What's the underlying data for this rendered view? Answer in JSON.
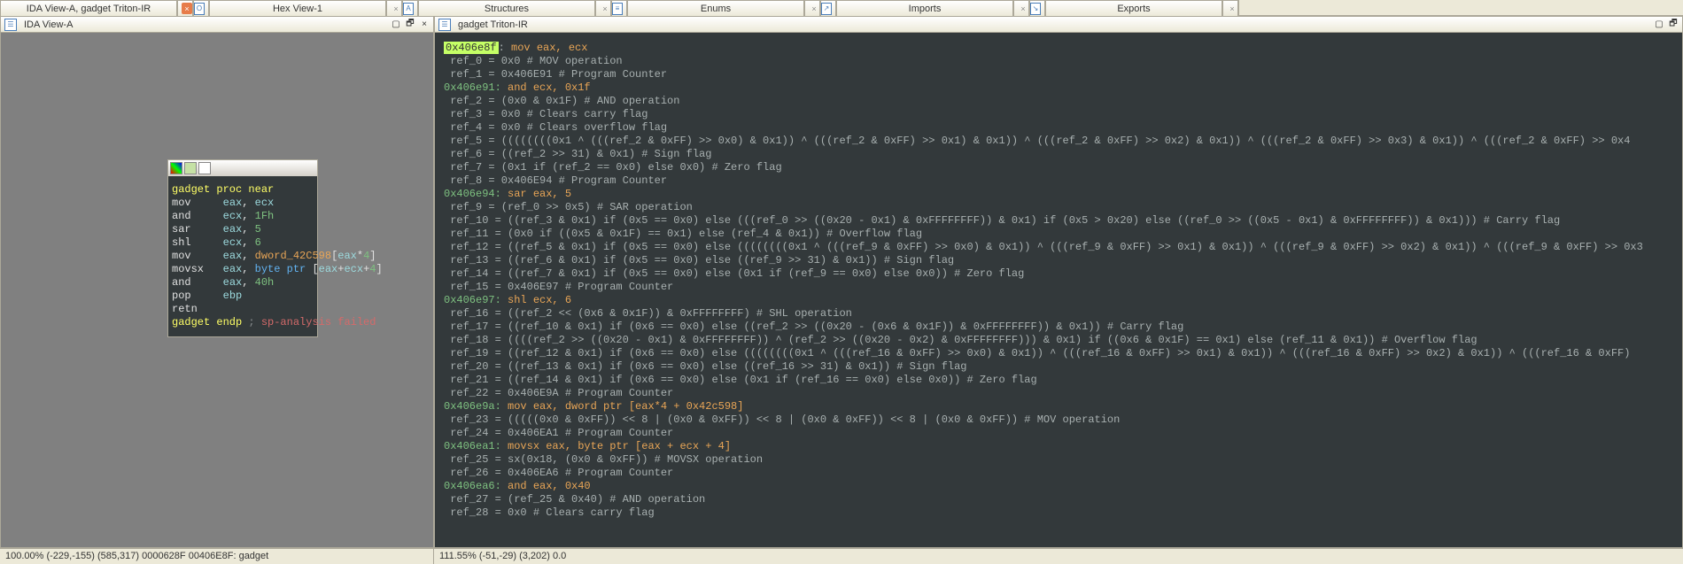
{
  "tabs": [
    {
      "label": "IDA View-A, gadget Triton-IR",
      "icon": "",
      "close_style": "orange"
    },
    {
      "label": "Hex View-1",
      "icon": "O"
    },
    {
      "label": "Structures",
      "icon": "A"
    },
    {
      "label": "Enums",
      "icon": "≡"
    },
    {
      "label": "Imports",
      "icon": "↗"
    },
    {
      "label": "Exports",
      "icon": "↘"
    }
  ],
  "left_pane": {
    "title": "IDA View-A",
    "code": [
      [
        {
          "t": "gadget proc near",
          "c": "hl-yellow"
        }
      ],
      [
        {
          "t": "mov",
          "c": "hl-white"
        },
        {
          "t": "     ",
          "c": ""
        },
        {
          "t": "eax",
          "c": "hl-lightblue"
        },
        {
          "t": ", ",
          "c": "hl-white"
        },
        {
          "t": "ecx",
          "c": "hl-lightblue"
        }
      ],
      [
        {
          "t": "and",
          "c": "hl-white"
        },
        {
          "t": "     ",
          "c": ""
        },
        {
          "t": "ecx",
          "c": "hl-lightblue"
        },
        {
          "t": ", ",
          "c": "hl-white"
        },
        {
          "t": "1Fh",
          "c": "hl-green"
        }
      ],
      [
        {
          "t": "sar",
          "c": "hl-white"
        },
        {
          "t": "     ",
          "c": ""
        },
        {
          "t": "eax",
          "c": "hl-lightblue"
        },
        {
          "t": ", ",
          "c": "hl-white"
        },
        {
          "t": "5",
          "c": "hl-green"
        }
      ],
      [
        {
          "t": "shl",
          "c": "hl-white"
        },
        {
          "t": "     ",
          "c": ""
        },
        {
          "t": "ecx",
          "c": "hl-lightblue"
        },
        {
          "t": ", ",
          "c": "hl-white"
        },
        {
          "t": "6",
          "c": "hl-green"
        }
      ],
      [
        {
          "t": "mov",
          "c": "hl-white"
        },
        {
          "t": "     ",
          "c": ""
        },
        {
          "t": "eax",
          "c": "hl-lightblue"
        },
        {
          "t": ", ",
          "c": "hl-white"
        },
        {
          "t": "dword_42C598",
          "c": "hl-orange"
        },
        {
          "t": "[",
          "c": "hl-white"
        },
        {
          "t": "eax",
          "c": "hl-lightblue"
        },
        {
          "t": "*",
          "c": "hl-white"
        },
        {
          "t": "4",
          "c": "hl-green"
        },
        {
          "t": "]",
          "c": "hl-white"
        }
      ],
      [
        {
          "t": "movsx",
          "c": "hl-white"
        },
        {
          "t": "   ",
          "c": ""
        },
        {
          "t": "eax",
          "c": "hl-lightblue"
        },
        {
          "t": ", ",
          "c": "hl-white"
        },
        {
          "t": "byte ptr ",
          "c": "hl-blue"
        },
        {
          "t": "[",
          "c": "hl-white"
        },
        {
          "t": "eax",
          "c": "hl-lightblue"
        },
        {
          "t": "+",
          "c": "hl-white"
        },
        {
          "t": "ecx",
          "c": "hl-lightblue"
        },
        {
          "t": "+",
          "c": "hl-white"
        },
        {
          "t": "4",
          "c": "hl-green"
        },
        {
          "t": "]",
          "c": "hl-white"
        }
      ],
      [
        {
          "t": "and",
          "c": "hl-white"
        },
        {
          "t": "     ",
          "c": ""
        },
        {
          "t": "eax",
          "c": "hl-lightblue"
        },
        {
          "t": ", ",
          "c": "hl-white"
        },
        {
          "t": "40h",
          "c": "hl-green"
        }
      ],
      [
        {
          "t": "pop",
          "c": "hl-white"
        },
        {
          "t": "     ",
          "c": ""
        },
        {
          "t": "ebp",
          "c": "hl-lightblue"
        }
      ],
      [
        {
          "t": "retn",
          "c": "hl-white"
        }
      ],
      [
        {
          "t": "gadget endp",
          "c": "hl-yellow"
        },
        {
          "t": " ; ",
          "c": "hl-gray"
        },
        {
          "t": "sp-analysis failed",
          "c": "hl-red"
        }
      ]
    ]
  },
  "right_pane": {
    "title": "gadget Triton-IR",
    "lines": [
      [
        {
          "t": "0x406e8f",
          "c": "addr-bg"
        },
        {
          "t": ": ",
          "c": ""
        },
        {
          "t": "mov eax, ecx",
          "c": "hl-orange"
        }
      ],
      [
        {
          "t": " ref_0 = 0x0 # MOV operation",
          "c": ""
        }
      ],
      [
        {
          "t": " ref_1 = 0x406E91 # Program Counter",
          "c": ""
        }
      ],
      [
        {
          "t": "0x406e91: ",
          "c": "hl-green"
        },
        {
          "t": "and ecx, 0x1f",
          "c": "hl-orange"
        }
      ],
      [
        {
          "t": " ref_2 = (0x0 & 0x1F) # AND operation",
          "c": ""
        }
      ],
      [
        {
          "t": " ref_3 = 0x0 # Clears carry flag",
          "c": ""
        }
      ],
      [
        {
          "t": " ref_4 = 0x0 # Clears overflow flag",
          "c": ""
        }
      ],
      [
        {
          "t": " ref_5 = ((((((((0x1 ^ (((ref_2 & 0xFF) >> 0x0) & 0x1)) ^ (((ref_2 & 0xFF) >> 0x1) & 0x1)) ^ (((ref_2 & 0xFF) >> 0x2) & 0x1)) ^ (((ref_2 & 0xFF) >> 0x3) & 0x1)) ^ (((ref_2 & 0xFF) >> 0x4",
          "c": ""
        }
      ],
      [
        {
          "t": " ref_6 = ((ref_2 >> 31) & 0x1) # Sign flag",
          "c": ""
        }
      ],
      [
        {
          "t": " ref_7 = (0x1 if (ref_2 == 0x0) else 0x0) # Zero flag",
          "c": ""
        }
      ],
      [
        {
          "t": " ref_8 = 0x406E94 # Program Counter",
          "c": ""
        }
      ],
      [
        {
          "t": "0x406e94: ",
          "c": "hl-green"
        },
        {
          "t": "sar eax, 5",
          "c": "hl-orange"
        }
      ],
      [
        {
          "t": " ref_9 = (ref_0 >> 0x5) # SAR operation",
          "c": ""
        }
      ],
      [
        {
          "t": " ref_10 = ((ref_3 & 0x1) if (0x5 == 0x0) else (((ref_0 >> ((0x20 - 0x1) & 0xFFFFFFFF)) & 0x1) if (0x5 > 0x20) else ((ref_0 >> ((0x5 - 0x1) & 0xFFFFFFFF)) & 0x1))) # Carry flag",
          "c": ""
        }
      ],
      [
        {
          "t": " ref_11 = (0x0 if ((0x5 & 0x1F) == 0x1) else (ref_4 & 0x1)) # Overflow flag",
          "c": ""
        }
      ],
      [
        {
          "t": " ref_12 = ((ref_5 & 0x1) if (0x5 == 0x0) else ((((((((0x1 ^ (((ref_9 & 0xFF) >> 0x0) & 0x1)) ^ (((ref_9 & 0xFF) >> 0x1) & 0x1)) ^ (((ref_9 & 0xFF) >> 0x2) & 0x1)) ^ (((ref_9 & 0xFF) >> 0x3",
          "c": ""
        }
      ],
      [
        {
          "t": " ref_13 = ((ref_6 & 0x1) if (0x5 == 0x0) else ((ref_9 >> 31) & 0x1)) # Sign flag",
          "c": ""
        }
      ],
      [
        {
          "t": " ref_14 = ((ref_7 & 0x1) if (0x5 == 0x0) else (0x1 if (ref_9 == 0x0) else 0x0)) # Zero flag",
          "c": ""
        }
      ],
      [
        {
          "t": " ref_15 = 0x406E97 # Program Counter",
          "c": ""
        }
      ],
      [
        {
          "t": "0x406e97: ",
          "c": "hl-green"
        },
        {
          "t": "shl ecx, 6",
          "c": "hl-orange"
        }
      ],
      [
        {
          "t": " ref_16 = ((ref_2 << (0x6 & 0x1F)) & 0xFFFFFFFF) # SHL operation",
          "c": ""
        }
      ],
      [
        {
          "t": " ref_17 = ((ref_10 & 0x1) if (0x6 == 0x0) else ((ref_2 >> ((0x20 - (0x6 & 0x1F)) & 0xFFFFFFFF)) & 0x1)) # Carry flag",
          "c": ""
        }
      ],
      [
        {
          "t": " ref_18 = ((((ref_2 >> ((0x20 - 0x1) & 0xFFFFFFFF)) ^ (ref_2 >> ((0x20 - 0x2) & 0xFFFFFFFF))) & 0x1) if ((0x6 & 0x1F) == 0x1) else (ref_11 & 0x1)) # Overflow flag",
          "c": ""
        }
      ],
      [
        {
          "t": " ref_19 = ((ref_12 & 0x1) if (0x6 == 0x0) else ((((((((0x1 ^ (((ref_16 & 0xFF) >> 0x0) & 0x1)) ^ (((ref_16 & 0xFF) >> 0x1) & 0x1)) ^ (((ref_16 & 0xFF) >> 0x2) & 0x1)) ^ (((ref_16 & 0xFF)",
          "c": ""
        }
      ],
      [
        {
          "t": " ref_20 = ((ref_13 & 0x1) if (0x6 == 0x0) else ((ref_16 >> 31) & 0x1)) # Sign flag",
          "c": ""
        }
      ],
      [
        {
          "t": " ref_21 = ((ref_14 & 0x1) if (0x6 == 0x0) else (0x1 if (ref_16 == 0x0) else 0x0)) # Zero flag",
          "c": ""
        }
      ],
      [
        {
          "t": " ref_22 = 0x406E9A # Program Counter",
          "c": ""
        }
      ],
      [
        {
          "t": "0x406e9a: ",
          "c": "hl-green"
        },
        {
          "t": "mov eax, dword ptr [eax*4 + 0x42c598]",
          "c": "hl-orange"
        }
      ],
      [
        {
          "t": " ref_23 = (((((0x0 & 0xFF)) << 8 | (0x0 & 0xFF)) << 8 | (0x0 & 0xFF)) << 8 | (0x0 & 0xFF)) # MOV operation",
          "c": ""
        }
      ],
      [
        {
          "t": " ref_24 = 0x406EA1 # Program Counter",
          "c": ""
        }
      ],
      [
        {
          "t": "0x406ea1: ",
          "c": "hl-green"
        },
        {
          "t": "movsx eax, byte ptr [eax + ecx + 4]",
          "c": "hl-orange"
        }
      ],
      [
        {
          "t": " ref_25 = sx(0x18, (0x0 & 0xFF)) # MOVSX operation",
          "c": ""
        }
      ],
      [
        {
          "t": " ref_26 = 0x406EA6 # Program Counter",
          "c": ""
        }
      ],
      [
        {
          "t": "0x406ea6: ",
          "c": "hl-green"
        },
        {
          "t": "and eax, 0x40",
          "c": "hl-orange"
        }
      ],
      [
        {
          "t": " ref_27 = (ref_25 & 0x40) # AND operation",
          "c": ""
        }
      ],
      [
        {
          "t": " ref_28 = 0x0 # Clears carry flag",
          "c": ""
        }
      ]
    ]
  },
  "status": {
    "left": "100.00%  (-229,-155)  (585,317) 0000628F 00406E8F: gadget",
    "right": "111.55%  (-51,-29)  (3,202)   0.0"
  }
}
